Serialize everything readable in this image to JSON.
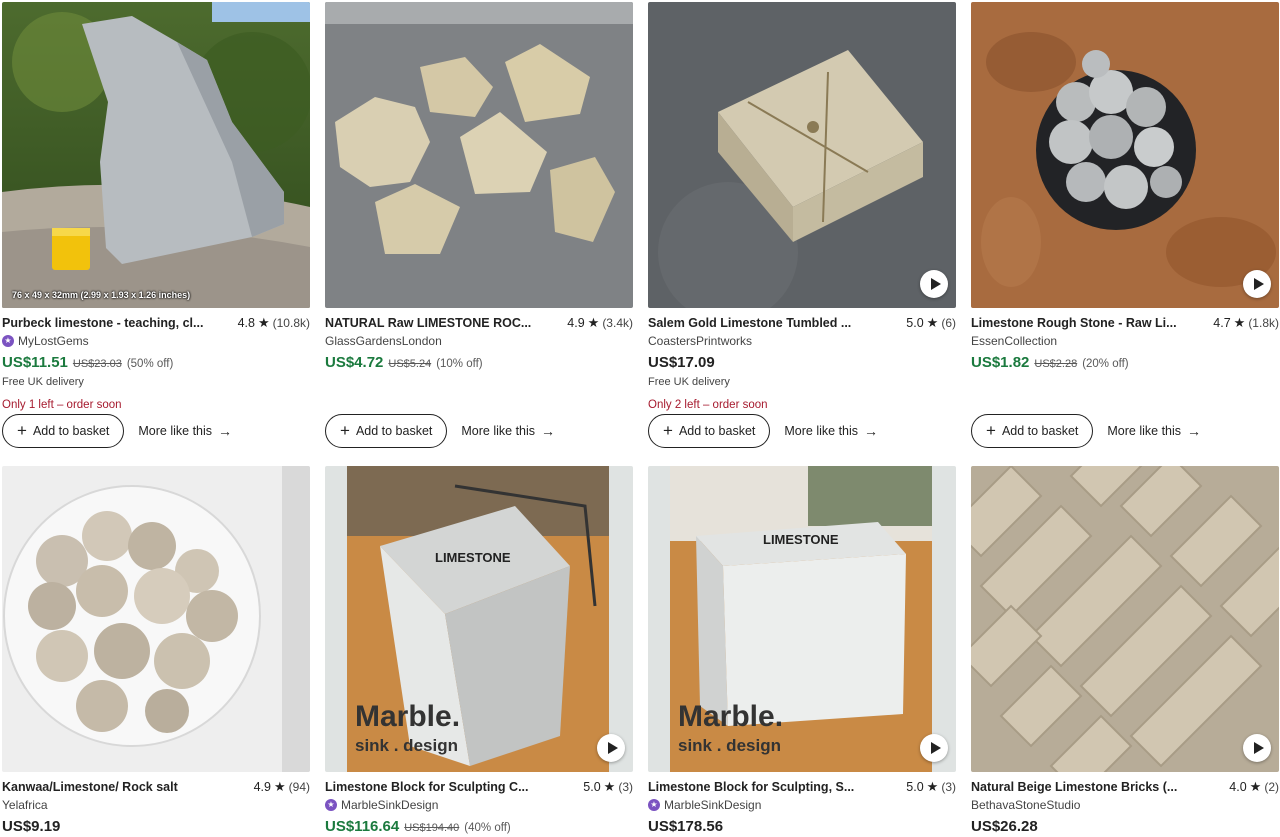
{
  "listings": [
    {
      "title": "Purbeck limestone - teaching, cl...",
      "rating": "4.8",
      "reviews": "(10.8k)",
      "shop": "MyLostGems",
      "star_seller": true,
      "price": "US$11.51",
      "original_price": "US$23.03",
      "discount": "(50% off)",
      "delivery": "Free UK delivery",
      "urgency": "Only 1 left – order soon",
      "image_label": "76 x 49 x 32mm (2.99 x 1.93 x 1.26 inches)",
      "has_video": false
    },
    {
      "title": "NATURAL Raw LIMESTONE ROC...",
      "rating": "4.9",
      "reviews": "(3.4k)",
      "shop": "GlassGardensLondon",
      "star_seller": false,
      "price": "US$4.72",
      "original_price": "US$5.24",
      "discount": "(10% off)",
      "has_video": false
    },
    {
      "title": "Salem Gold Limestone Tumbled ...",
      "rating": "5.0",
      "reviews": "(6)",
      "shop": "CoastersPrintworks",
      "star_seller": false,
      "price": "US$17.09",
      "delivery": "Free UK delivery",
      "urgency": "Only 2 left – order soon",
      "has_video": true
    },
    {
      "title": "Limestone Rough Stone - Raw Li...",
      "rating": "4.7",
      "reviews": "(1.8k)",
      "shop": "EssenCollection",
      "star_seller": false,
      "price": "US$1.82",
      "original_price": "US$2.28",
      "discount": "(20% off)",
      "has_video": true
    },
    {
      "title": "Kanwaa/Limestone/ Rock salt",
      "rating": "4.9",
      "reviews": "(94)",
      "shop": "Yelafrica",
      "star_seller": false,
      "price": "US$9.19",
      "has_video": false
    },
    {
      "title": "Limestone Block for Sculpting C...",
      "rating": "5.0",
      "reviews": "(3)",
      "shop": "MarbleSinkDesign",
      "star_seller": true,
      "price": "US$116.64",
      "original_price": "US$194.40",
      "discount": "(40% off)",
      "image_label": "LIMESTONE",
      "brand_line1": "Marble.",
      "brand_line2": "sink . design",
      "has_video": true
    },
    {
      "title": "Limestone Block for Sculpting, S...",
      "rating": "5.0",
      "reviews": "(3)",
      "shop": "MarbleSinkDesign",
      "star_seller": true,
      "price": "US$178.56",
      "image_label": "LIMESTONE",
      "brand_line1": "Marble.",
      "brand_line2": "sink . design",
      "has_video": true
    },
    {
      "title": "Natural Beige Limestone Bricks (...",
      "rating": "4.0",
      "reviews": "(2)",
      "shop": "BethavaStoneStudio",
      "star_seller": false,
      "price": "US$26.28",
      "has_video": true
    }
  ],
  "ui": {
    "add_to_basket": "Add to basket",
    "more_like_this": "More like this",
    "plus_icon": "plus-icon",
    "arrow_icon": "arrow-right-icon",
    "star_icon": "star-icon",
    "star_seller_icon": "star-seller-badge-icon",
    "play_icon": "play-icon"
  },
  "colors": {
    "sale_price": "#1b7a3e",
    "urgency": "#a61a2e",
    "star_seller": "#7b53c1"
  }
}
